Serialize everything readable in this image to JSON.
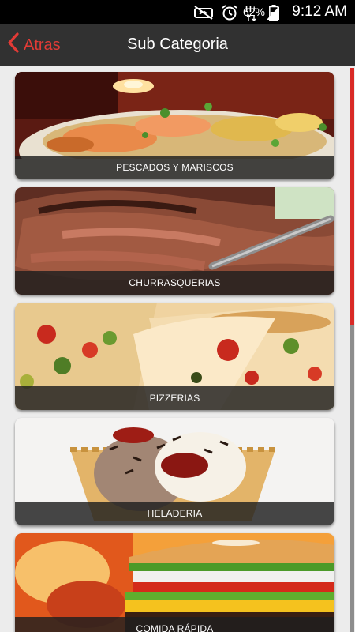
{
  "status_bar": {
    "battery_percent": "62%",
    "time": "9:12 AM",
    "icons": [
      "mute-icon",
      "alarm-icon",
      "data-arrows-icon",
      "signal-icon",
      "battery-icon"
    ]
  },
  "header": {
    "back_label": "Atras",
    "title": "Sub Categoria"
  },
  "categories": [
    {
      "label": "PESCADOS Y MARISCOS"
    },
    {
      "label": "CHURRASQUERIAS"
    },
    {
      "label": "PIZZERIAS"
    },
    {
      "label": "HELADERIA"
    },
    {
      "label": "COMIDA RÁPIDA"
    }
  ],
  "colors": {
    "accent": "#e23b36",
    "app_bar": "#313131",
    "background": "#ececec"
  }
}
